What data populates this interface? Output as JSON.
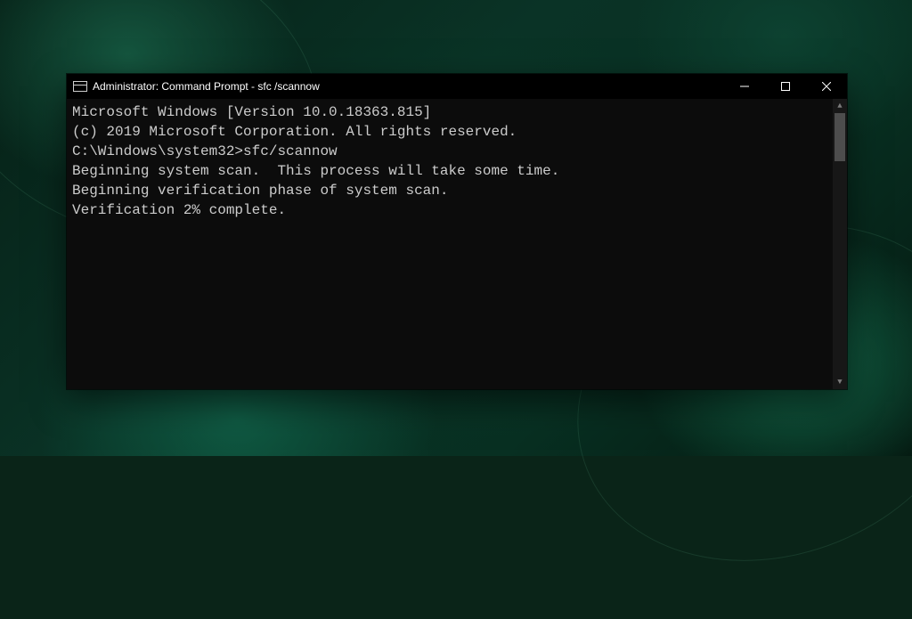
{
  "window": {
    "title": "Administrator: Command Prompt - sfc /scannow",
    "icon": "command-prompt-icon"
  },
  "terminal": {
    "lines": [
      "Microsoft Windows [Version 10.0.18363.815]",
      "(c) 2019 Microsoft Corporation. All rights reserved.",
      "",
      "C:\\Windows\\system32>sfc/scannow",
      "",
      "Beginning system scan.  This process will take some time.",
      "",
      "Beginning verification phase of system scan.",
      "Verification 2% complete."
    ]
  },
  "controls": {
    "minimize": "minimize",
    "maximize": "maximize",
    "close": "close"
  }
}
